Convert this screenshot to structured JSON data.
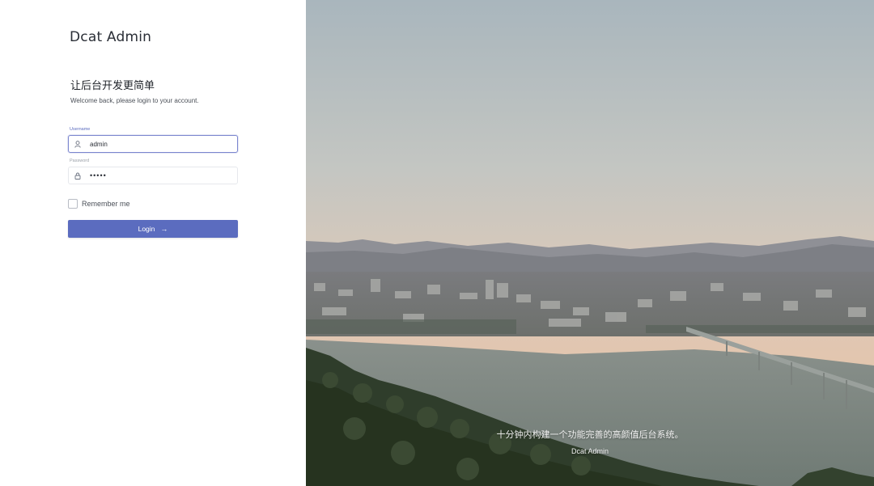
{
  "brand": {
    "name": "Dcat Admin"
  },
  "login": {
    "heading": "让后台开发更简单",
    "subheading": "Welcome back, please login to your account.",
    "username": {
      "label": "Username",
      "value": "admin",
      "icon": "user-icon"
    },
    "password": {
      "label": "Password",
      "value": "•••••",
      "icon": "lock-icon"
    },
    "remember_label": "Remember me",
    "submit_label": "Login",
    "submit_icon": "arrow-right-icon"
  },
  "background": {
    "caption": "十分钟内构建一个功能完善的高颜值后台系统。",
    "subcaption": "Dcat Admin"
  },
  "colors": {
    "accent": "#5b6cbf",
    "focus_border": "#7b86cf"
  }
}
